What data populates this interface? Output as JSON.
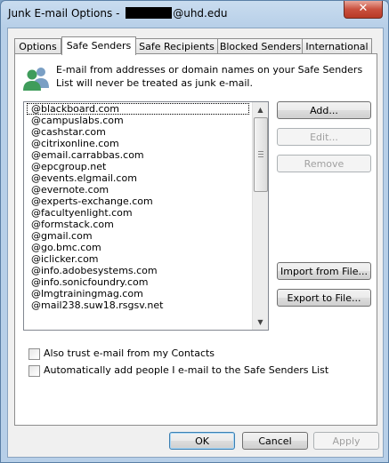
{
  "window": {
    "title_prefix": "Junk E-mail Options - ",
    "title_suffix": "@uhd.edu",
    "close_glyph": "✕"
  },
  "tabs": [
    {
      "label": "Options",
      "active": false
    },
    {
      "label": "Safe Senders",
      "active": true
    },
    {
      "label": "Safe Recipients",
      "active": false
    },
    {
      "label": "Blocked Senders",
      "active": false
    },
    {
      "label": "International",
      "active": false
    }
  ],
  "description": "E-mail from addresses or domain names on your Safe Senders List will never be treated as junk e-mail.",
  "icons": {
    "header": "people-icon"
  },
  "safe_senders": [
    "@blackboard.com",
    "@campuslabs.com",
    "@cashstar.com",
    "@citrixonline.com",
    "@email.carrabbas.com",
    "@epcgroup.net",
    "@events.elgmail.com",
    "@evernote.com",
    "@experts-exchange.com",
    "@facultyenlight.com",
    "@formstack.com",
    "@gmail.com",
    "@go.bmc.com",
    "@iclicker.com",
    "@info.adobesystems.com",
    "@info.sonicfoundry.com",
    "@lmgtrainingmag.com",
    "@mail238.suw18.rsgsv.net"
  ],
  "buttons": {
    "add": "Add...",
    "edit": "Edit...",
    "remove": "Remove",
    "import": "Import from File...",
    "export": "Export to File..."
  },
  "checkboxes": {
    "trust_contacts": "Also trust e-mail from my Contacts",
    "auto_add": "Automatically add people I e-mail to the Safe Senders List"
  },
  "footer": {
    "ok": "OK",
    "cancel": "Cancel",
    "apply": "Apply"
  }
}
